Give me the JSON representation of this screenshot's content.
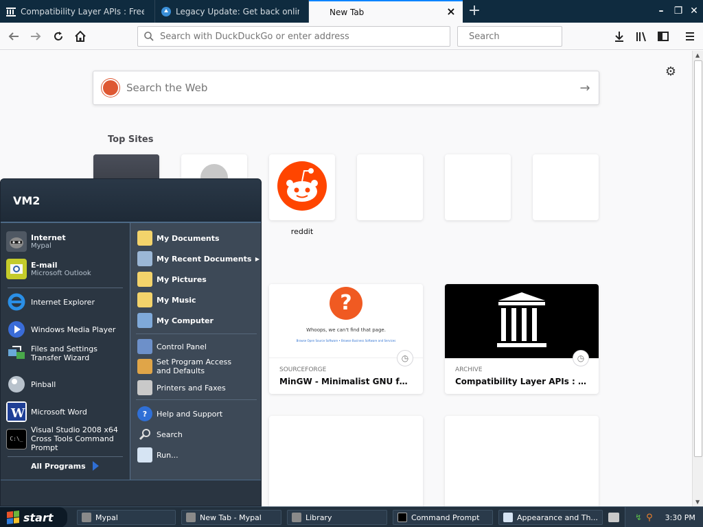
{
  "browser": {
    "tabs": [
      {
        "title": "Compatibility Layer APIs : Free Download",
        "favicon": "archive-icon"
      },
      {
        "title": "Legacy Update: Get back online, activate",
        "favicon": "legacy-update-icon"
      },
      {
        "title": "New Tab",
        "favicon": "none",
        "active": true
      }
    ],
    "urlbar_placeholder": "Search with DuckDuckGo or enter address",
    "searchbar_placeholder": "Search"
  },
  "newtab": {
    "websearch_placeholder": "Search the Web",
    "topsites_title": "Top Sites",
    "tiles": [
      {
        "label": ""
      },
      {
        "label": ""
      },
      {
        "label": "reddit"
      },
      {
        "label": ""
      },
      {
        "label": ""
      },
      {
        "label": ""
      }
    ],
    "highlights": [
      {
        "source": "SOURCEFORGE",
        "title": "MinGW - Minimalist GNU for Wi...",
        "preview_text": "Whoops, we can't find that page.",
        "preview_subtext": "Browse Open Source Software • Browse Business Software and Services"
      },
      {
        "source": "ARCHIVE",
        "title": "Compatibility Layer APIs : Free D..."
      }
    ]
  },
  "startmenu": {
    "user": "VM2",
    "pinned": [
      {
        "title": "Internet",
        "subtitle": "Mypal"
      },
      {
        "title": "E-mail",
        "subtitle": "Microsoft Outlook"
      }
    ],
    "recent": [
      "Internet Explorer",
      "Windows Media Player",
      "Files and Settings Transfer Wizard",
      "Pinball",
      "Microsoft Word",
      "Visual Studio 2008 x64 Cross Tools Command Prompt"
    ],
    "all_programs": "All Programs",
    "right": {
      "my_documents": "My Documents",
      "my_recent_documents": "My Recent Documents",
      "my_pictures": "My Pictures",
      "my_music": "My Music",
      "my_computer": "My Computer",
      "control_panel": "Control Panel",
      "set_program_access": "Set Program Access and Defaults",
      "printers_faxes": "Printers and Faxes",
      "help_support": "Help and Support",
      "search": "Search",
      "run": "Run..."
    }
  },
  "taskbar": {
    "start_label": "start",
    "items": [
      "Mypal",
      "New Tab - Mypal",
      "Library",
      "Command Prompt",
      "Appearance and Th..."
    ],
    "clock": "3:30 PM"
  },
  "colors": {
    "tabstrip_bg": "#0f2b3f",
    "accent": "#0a84ff",
    "reddit": "#ff4500",
    "ddg": "#de5833"
  }
}
